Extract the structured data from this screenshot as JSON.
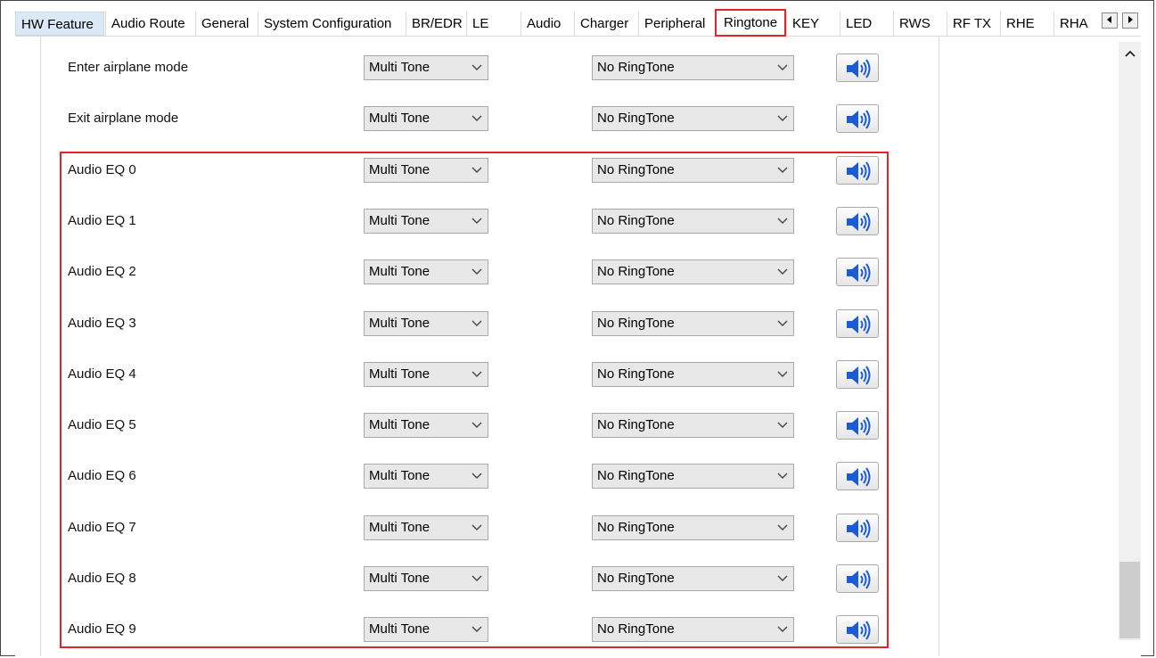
{
  "tabs": [
    {
      "label": "HW Feature"
    },
    {
      "label": "Audio Route"
    },
    {
      "label": "General"
    },
    {
      "label": "System Configuration"
    },
    {
      "label": "BR/EDR"
    },
    {
      "label": "LE"
    },
    {
      "label": "Audio"
    },
    {
      "label": "Charger"
    },
    {
      "label": "Peripheral"
    },
    {
      "label": "Ringtone"
    },
    {
      "label": "KEY"
    },
    {
      "label": "LED"
    },
    {
      "label": "RWS"
    },
    {
      "label": "RF TX"
    },
    {
      "label": "RHE"
    },
    {
      "label": "RHA"
    }
  ],
  "selected_tab": "Ringtone",
  "tab_scroll": {
    "left_icon": "arrow-left-icon",
    "right_icon": "arrow-right-icon"
  },
  "rows": [
    {
      "label": "Enter airplane mode",
      "tone": "Multi Tone",
      "ringtone": "No RingTone"
    },
    {
      "label": "Exit airplane mode",
      "tone": "Multi Tone",
      "ringtone": "No RingTone"
    },
    {
      "label": "Audio EQ 0",
      "tone": "Multi Tone",
      "ringtone": "No RingTone"
    },
    {
      "label": "Audio EQ 1",
      "tone": "Multi Tone",
      "ringtone": "No RingTone"
    },
    {
      "label": "Audio EQ 2",
      "tone": "Multi Tone",
      "ringtone": "No RingTone"
    },
    {
      "label": "Audio EQ 3",
      "tone": "Multi Tone",
      "ringtone": "No RingTone"
    },
    {
      "label": "Audio EQ 4",
      "tone": "Multi Tone",
      "ringtone": "No RingTone"
    },
    {
      "label": "Audio EQ 5",
      "tone": "Multi Tone",
      "ringtone": "No RingTone"
    },
    {
      "label": "Audio EQ 6",
      "tone": "Multi Tone",
      "ringtone": "No RingTone"
    },
    {
      "label": "Audio EQ 7",
      "tone": "Multi Tone",
      "ringtone": "No RingTone"
    },
    {
      "label": "Audio EQ 8",
      "tone": "Multi Tone",
      "ringtone": "No RingTone"
    },
    {
      "label": "Audio EQ 9",
      "tone": "Multi Tone",
      "ringtone": "No RingTone"
    }
  ],
  "icons": {
    "play": "speaker-icon",
    "dropdown": "chevron-down-icon",
    "scroll_up": "chevron-up-icon"
  },
  "colors": {
    "highlight": "#e0262b",
    "speaker": "#1a5bd6",
    "selected_first_tab": "#dbe8f5"
  }
}
